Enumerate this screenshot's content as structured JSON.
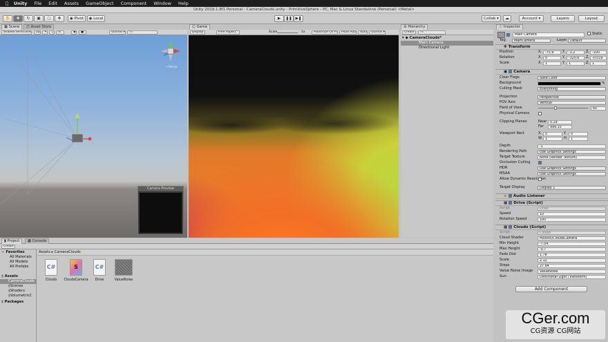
{
  "mac_menu": [
    "Unity",
    "File",
    "Edit",
    "Assets",
    "GameObject",
    "Component",
    "Window",
    "Help"
  ],
  "window_title": "Unity 2019.1.8f1 Personal - CameraClouds.unity - PrimitiveSphere - PC, Mac & Linux Standalone (Personal) <Metal>",
  "toolbar": {
    "pivot": "Pivot",
    "local": "Local",
    "collab": "Collab ▾",
    "account": "Account ▾",
    "layers": "Layers",
    "layout": "Layout"
  },
  "scene": {
    "tab_scene": "Scene",
    "tab_asset_store": "Asset Store",
    "shading": "Shaded Wireframe",
    "mode_2d": "2D",
    "gizmos": "Gizmos ▾",
    "search_placeholder": "All",
    "persp": "←Persp",
    "camera_preview": "Camera Preview"
  },
  "game": {
    "tab": "Game",
    "display": "Display 1",
    "aspect": "Free Aspect",
    "scale_label": "Scale",
    "scale_value": "1x",
    "maximize": "Maximize On Play",
    "mute": "Mute Audio",
    "stats": "Stats",
    "gizmos": "Gizmos ▾"
  },
  "hierarchy": {
    "tab": "Hierarchy",
    "create": "Create ▾",
    "search_placeholder": "All",
    "scene": "CameraClouds*",
    "items": [
      "Main Camera",
      "Directional Light"
    ]
  },
  "inspector": {
    "tab": "Inspector",
    "object_name": "Main Camera",
    "static": "Static",
    "tag_label": "Tag",
    "tag_value": "MainCamera",
    "layer_label": "Layer",
    "layer_value": "Default",
    "transform": {
      "title": "Transform",
      "rows": [
        {
          "label": "Position",
          "x": "-75.9",
          "y": "-1.2",
          "z": "-100"
        },
        {
          "label": "Rotation",
          "x": "0",
          "y": "-320.6",
          "z": "-0.019"
        },
        {
          "label": "Scale",
          "x": "1",
          "y": "1",
          "z": "1"
        }
      ]
    },
    "camera": {
      "title": "Camera",
      "clear_flags": "Solid Color",
      "background_label": "Background",
      "culling_mask": "Everything",
      "projection": "Perspective",
      "fov_axis": "Vertical",
      "fov": "60",
      "physical": "Physical Camera",
      "clip_label": "Clipping Planes",
      "near_label": "Near",
      "near": "0.29",
      "far_label": "Far",
      "far": "999.15",
      "viewport_label": "Viewport Rect",
      "vx": "0",
      "vy": "0",
      "vw": "1",
      "vh": "1",
      "depth": "-1",
      "rendering_path": "Use Graphics Settings",
      "target_texture": "None (Render Texture)",
      "hdr": "Use Graphics Settings",
      "msaa": "Use Graphics Settings",
      "target_display": "Display 1",
      "labels": [
        "Clear Flags",
        "Background",
        "Culling Mask",
        "Projection",
        "FOV Axis",
        "Field of View",
        "Physical Camera",
        "Depth",
        "Rendering Path",
        "Target Texture",
        "Occlusion Culling",
        "HDR",
        "MSAA",
        "Allow Dynamic Resolution",
        "Target Display"
      ]
    },
    "audio_listener": "Audio Listener",
    "drive": {
      "title": "Drive (Script)",
      "script_label": "Script",
      "script": "Drive",
      "speed_label": "Speed",
      "speed": "10",
      "rot_label": "Rotation Speed",
      "rot": "100"
    },
    "clouds": {
      "title": "Clouds (Script)",
      "script_label": "Script",
      "script": "Clouds",
      "rows": [
        {
          "label": "Cloud Shader",
          "value": "Holistic/CloudsCamera"
        },
        {
          "label": "Min Height",
          "value": "-7.04"
        },
        {
          "label": "Max Height",
          "value": "-0.7"
        },
        {
          "label": "Fade Dist",
          "value": "1.76"
        },
        {
          "label": "Scale",
          "value": "2.12"
        },
        {
          "label": "Steps",
          "value": "27.94"
        },
        {
          "label": "Value Noise Image",
          "value": "ValueNoise"
        },
        {
          "label": "Sun",
          "value": "Directional Light (Transform)"
        }
      ]
    },
    "add_component": "Add Component"
  },
  "project": {
    "tab_project": "Project",
    "tab_console": "Console",
    "create": "Create ▾",
    "favorites": "Favorites",
    "fav_items": [
      "All Materials",
      "All Models",
      "All Prefabs"
    ],
    "assets": "Assets",
    "asset_items": [
      "CameraClouds",
      "Scenes",
      "Shaders",
      "VolumetricC"
    ],
    "packages": "Packages",
    "breadcrumb_root": "Assets",
    "breadcrumb_leaf": "CameraClouds",
    "files": [
      {
        "name": "Clouds",
        "glyph": "C#"
      },
      {
        "name": "CloudsCamera",
        "glyph": "S"
      },
      {
        "name": "Drive",
        "glyph": "C#"
      },
      {
        "name": "ValueNoise",
        "glyph": ""
      }
    ]
  },
  "watermark": {
    "brand": "CGer.com",
    "sub": "CG资源  CG网站"
  },
  "colors": {
    "accent_blue": "#3e7fd6",
    "sky_top": "#7fa9d9",
    "ground": "#6a6664",
    "game_dark": "#0d0d0d"
  }
}
